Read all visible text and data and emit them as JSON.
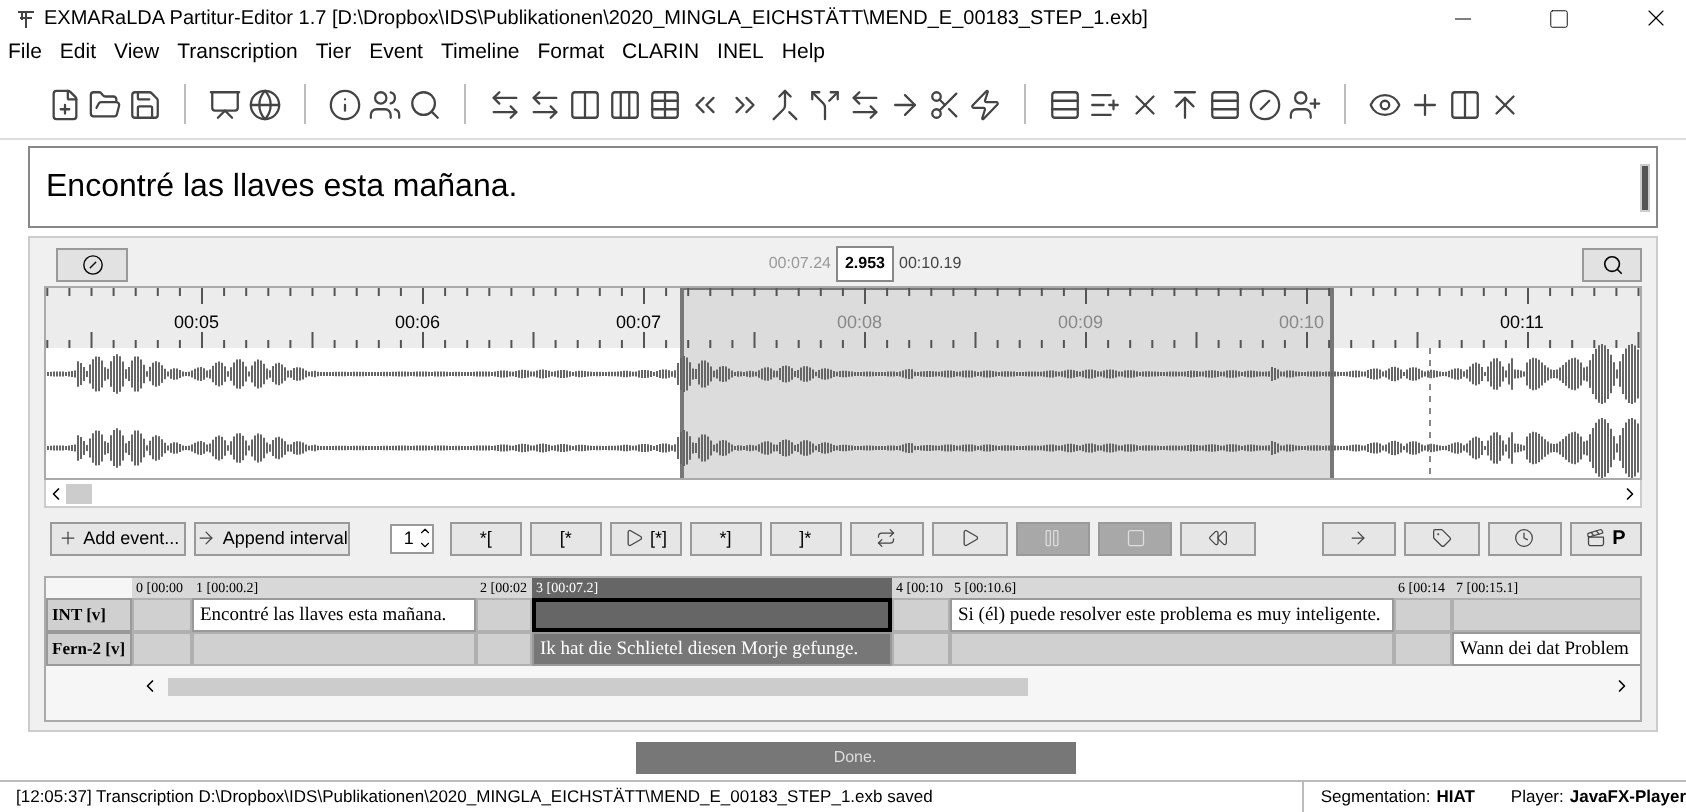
{
  "window": {
    "title": "EXMARaLDA Partitur-Editor 1.7 [D:\\Dropbox\\IDS\\Publikationen\\2020_MINGLA_EICHSTÄTT\\MEND_E_00183_STEP_1.exb]"
  },
  "menu": [
    "File",
    "Edit",
    "View",
    "Transcription",
    "Tier",
    "Event",
    "Timeline",
    "Format",
    "CLARIN",
    "INEL",
    "Help"
  ],
  "editor": {
    "value": "Encontré las llaves esta mañana."
  },
  "time_display": {
    "start": "00:07.24",
    "duration": "2.953",
    "end": "00:10.19"
  },
  "ruler": {
    "labels": [
      "00:05",
      "00:06",
      "00:07",
      "00:08",
      "00:09",
      "00:10",
      "00:11"
    ]
  },
  "controls": [
    {
      "kind": "icon-text",
      "label": "Add event..."
    },
    {
      "kind": "icon-text",
      "label": "Append interval"
    },
    {
      "kind": "spinner",
      "label": "1"
    },
    {
      "kind": "text",
      "label": "*["
    },
    {
      "kind": "text",
      "label": "[*"
    },
    {
      "kind": "icon-text",
      "label": "[*]"
    },
    {
      "kind": "text",
      "label": "*]"
    },
    {
      "kind": "text",
      "label": "]*"
    },
    {
      "kind": "icon",
      "disabled": false
    },
    {
      "kind": "icon",
      "disabled": false
    },
    {
      "kind": "icon",
      "disabled": true
    },
    {
      "kind": "icon",
      "disabled": true
    },
    {
      "kind": "icon",
      "disabled": false
    },
    {
      "kind": "gap"
    },
    {
      "kind": "icon",
      "disabled": false
    },
    {
      "kind": "icon",
      "disabled": false
    },
    {
      "kind": "icon",
      "disabled": false
    },
    {
      "kind": "icon-text",
      "label": "P"
    }
  ],
  "partitur": {
    "columns": [
      {
        "label": "0 [00:00",
        "selected": false
      },
      {
        "label": "1 [00:00.2]",
        "selected": false
      },
      {
        "label": "2 [00:02",
        "selected": false
      },
      {
        "label": "3 [00:07.2]",
        "selected": true
      },
      {
        "label": "4 [00:10",
        "selected": false
      },
      {
        "label": "5 [00:10.6]",
        "selected": false
      },
      {
        "label": "6 [00:14",
        "selected": false
      },
      {
        "label": "7 [00:15.1]",
        "selected": false
      }
    ],
    "tiers": [
      {
        "label": "INT [v]",
        "cells": [
          {
            "text": "",
            "selected": false
          },
          {
            "text": "Encontré las llaves esta mañana.",
            "selected": false
          },
          {
            "text": "",
            "selected": false
          },
          {
            "text": "",
            "selected": true
          },
          {
            "text": "",
            "selected": false
          },
          {
            "text": "Si (él) puede resolver este problema es muy inteligente.",
            "selected": false
          },
          {
            "text": "",
            "selected": false
          },
          {
            "text": "",
            "selected": false
          }
        ]
      },
      {
        "label": "Fern-2 [v]",
        "cells": [
          {
            "text": "",
            "selected": false
          },
          {
            "text": "",
            "selected": false
          },
          {
            "text": "",
            "selected": false
          },
          {
            "text": "Ik hat die Schlietel diesen Morje gefunge.",
            "selected": false
          },
          {
            "text": "",
            "selected": false
          },
          {
            "text": "",
            "selected": false
          },
          {
            "text": "",
            "selected": false
          },
          {
            "text": "Wann dei dat Problem",
            "selected": false
          }
        ]
      }
    ]
  },
  "progress": {
    "label": "Done.",
    "level": 1
  },
  "status_bar": {
    "message": "[12:05:37] Transcription D:\\Dropbox\\IDS\\Publikationen\\2020_MINGLA_EICHSTÄTT\\MEND_E_00183_STEP_1.exb saved",
    "segmentation_label": "Segmentation:",
    "segmentation": "HIAT",
    "player_label": "Player:",
    "player": "JavaFX-Player"
  }
}
